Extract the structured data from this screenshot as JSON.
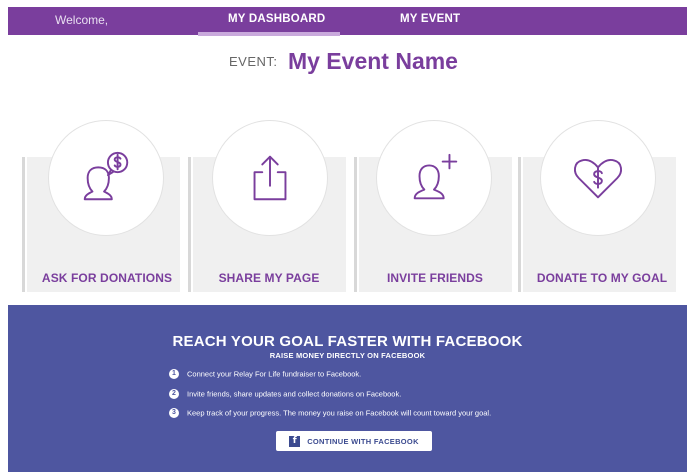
{
  "nav": {
    "welcome": "Welcome,",
    "tabs": [
      "MY DASHBOARD",
      "MY EVENT"
    ],
    "active_tab": "MY DASHBOARD"
  },
  "event": {
    "label": "EVENT:",
    "name": "My Event Name"
  },
  "actions": [
    {
      "label": "ASK FOR DONATIONS",
      "icon": "ask-donation-icon"
    },
    {
      "label": "SHARE MY PAGE",
      "icon": "share-icon"
    },
    {
      "label": "INVITE FRIENDS",
      "icon": "invite-friend-icon"
    },
    {
      "label": "DONATE TO MY GOAL",
      "icon": "heart-dollar-icon"
    }
  ],
  "facebook": {
    "title": "REACH YOUR GOAL FASTER WITH FACEBOOK",
    "subtitle": "RAISE MONEY DIRECTLY ON FACEBOOK",
    "steps": [
      {
        "num": "1",
        "text": "Connect your Relay For Life fundraiser to Facebook."
      },
      {
        "num": "2",
        "text": "Invite friends, share updates and collect donations on Facebook."
      },
      {
        "num": "3",
        "text": "Keep track of your progress. The money you raise on Facebook will count toward your goal."
      }
    ],
    "button_label": "CONTINUE WITH FACEBOOK",
    "button_icon": "facebook-icon"
  },
  "colors": {
    "primary": "#7a3e9d",
    "facebook_bg": "#4e56a0",
    "card_bg": "#f0f0f0"
  }
}
